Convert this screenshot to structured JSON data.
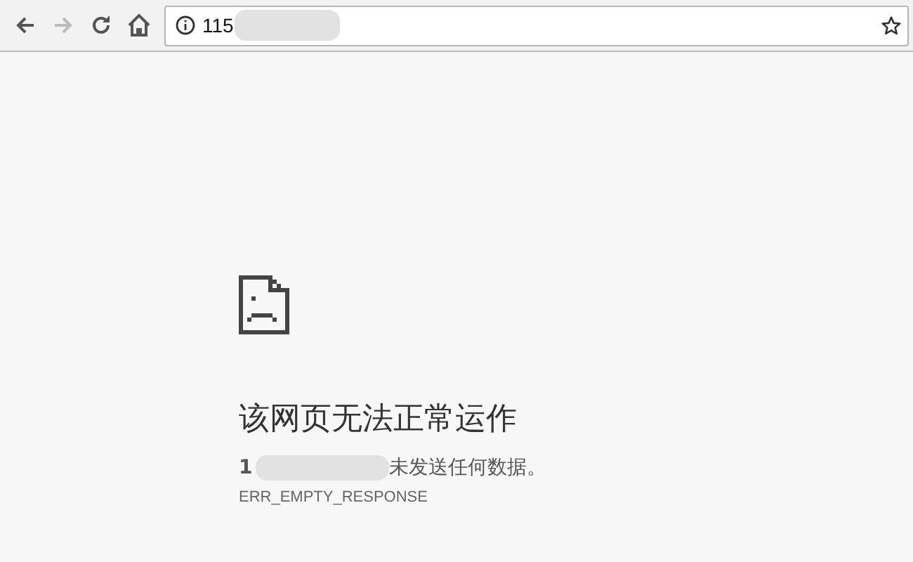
{
  "toolbar": {
    "nav_buttons": [
      {
        "kind": "back",
        "disabled": false
      },
      {
        "kind": "forward",
        "disabled": true
      },
      {
        "kind": "reload",
        "disabled": false
      },
      {
        "kind": "home",
        "disabled": false
      }
    ],
    "address": "115"
  },
  "error": {
    "title": "该网页无法正常运作",
    "host_start": "1",
    "message": "未发送任何数据。",
    "code": "ERR_EMPTY_RESPONSE"
  }
}
